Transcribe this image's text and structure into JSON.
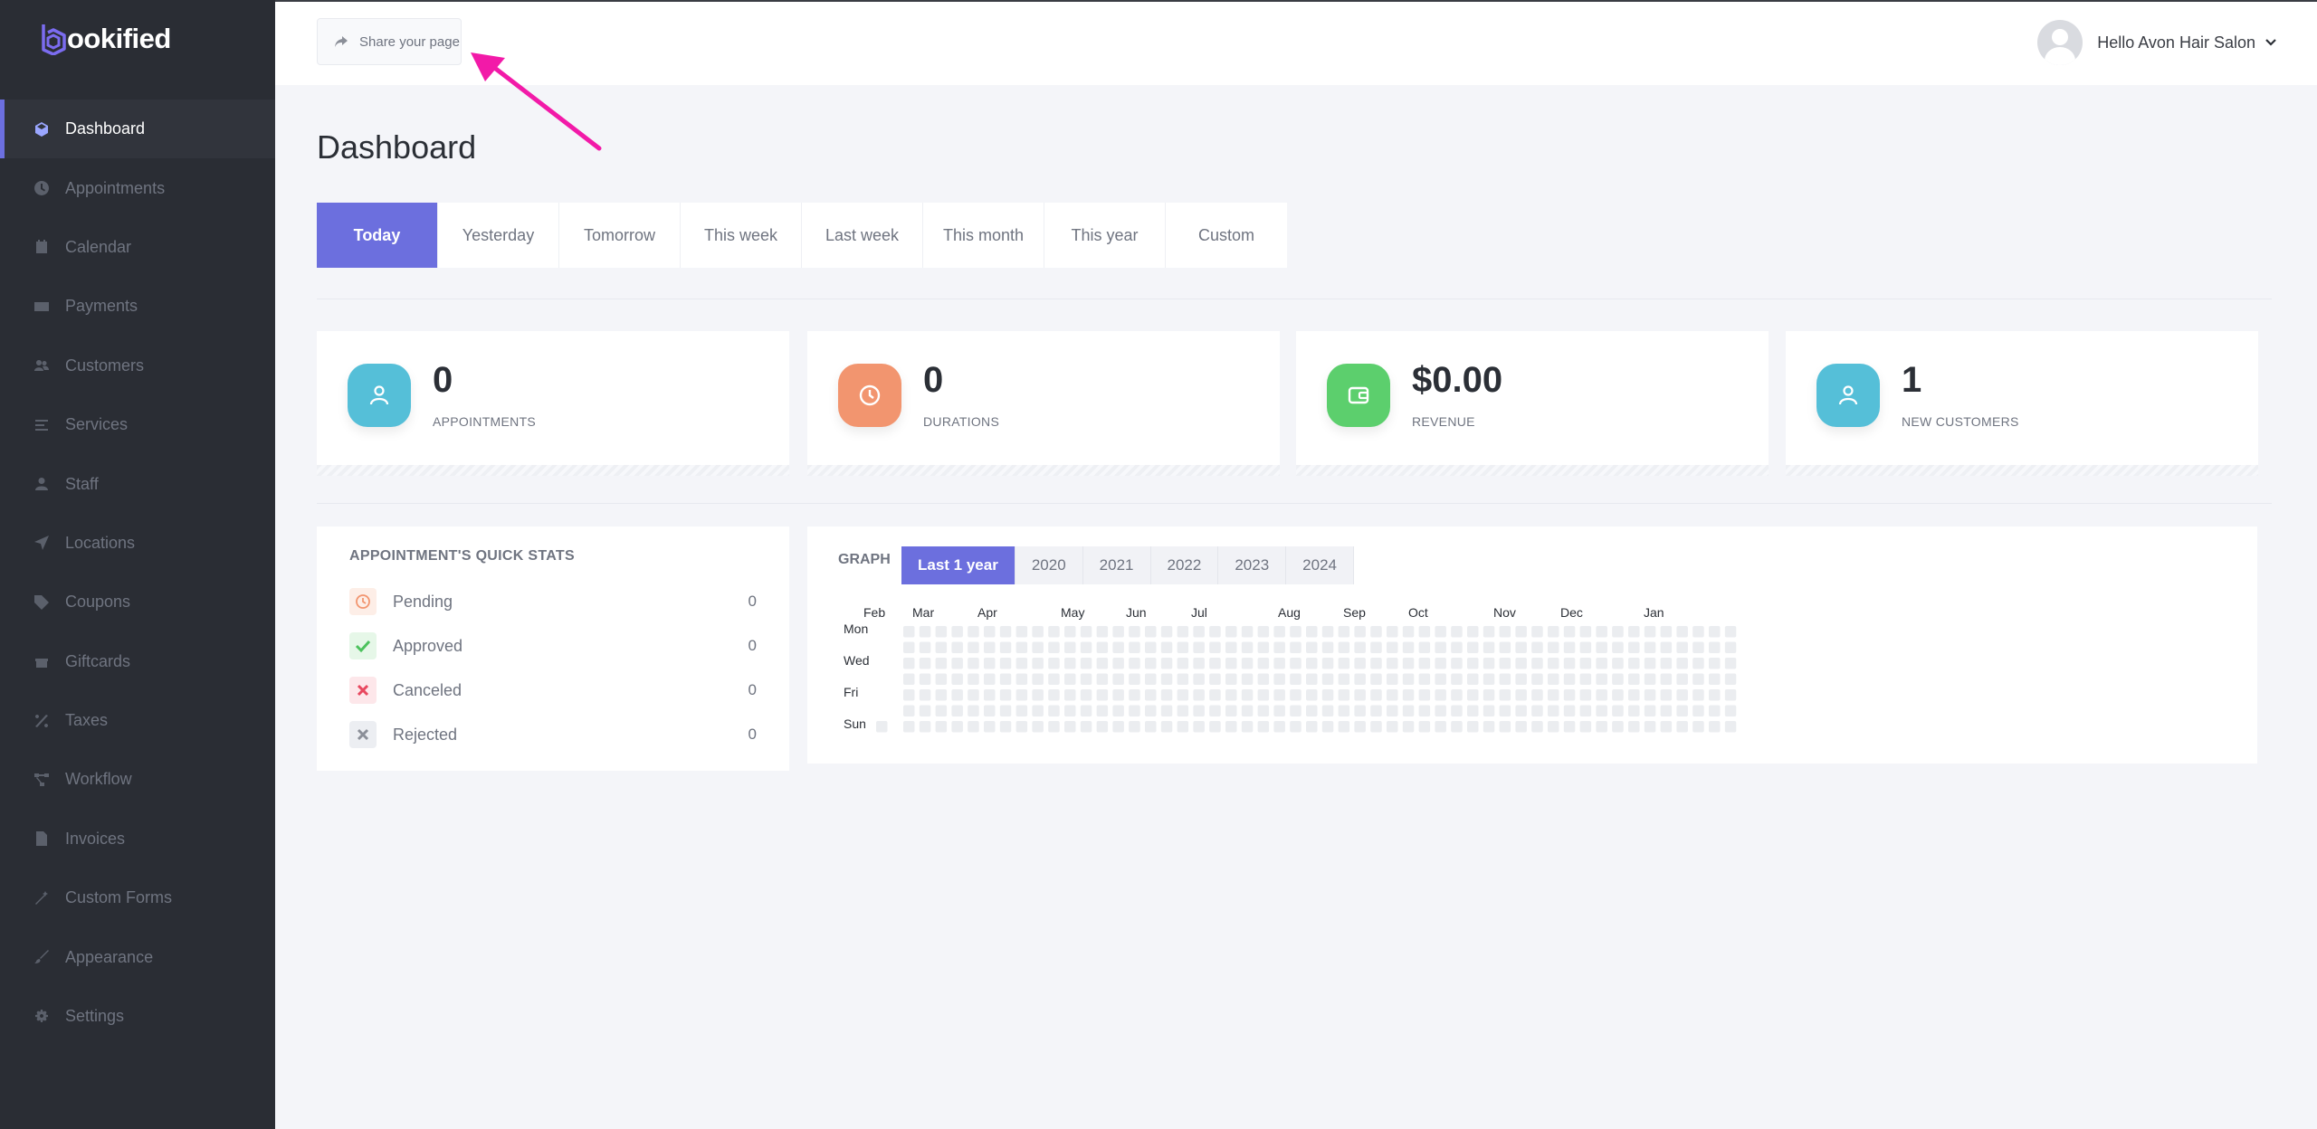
{
  "brand": {
    "logo_text": "ookified",
    "accent": "#6c6fde"
  },
  "sidebar": {
    "items": [
      {
        "label": "Dashboard",
        "icon": "cube-icon",
        "active": true
      },
      {
        "label": "Appointments",
        "icon": "clock-icon"
      },
      {
        "label": "Calendar",
        "icon": "calendar-icon"
      },
      {
        "label": "Payments",
        "icon": "credit-card-icon"
      },
      {
        "label": "Customers",
        "icon": "users-icon"
      },
      {
        "label": "Services",
        "icon": "list-icon"
      },
      {
        "label": "Staff",
        "icon": "user-icon"
      },
      {
        "label": "Locations",
        "icon": "location-arrow-icon"
      },
      {
        "label": "Coupons",
        "icon": "tag-icon"
      },
      {
        "label": "Giftcards",
        "icon": "gift-icon"
      },
      {
        "label": "Taxes",
        "icon": "percent-icon"
      },
      {
        "label": "Workflow",
        "icon": "workflow-icon"
      },
      {
        "label": "Invoices",
        "icon": "file-icon"
      },
      {
        "label": "Custom Forms",
        "icon": "magic-icon"
      },
      {
        "label": "Appearance",
        "icon": "brush-icon"
      },
      {
        "label": "Settings",
        "icon": "gear-icon"
      }
    ]
  },
  "topbar": {
    "share_label": "Share your page",
    "greeting": "Hello Avon Hair Salon"
  },
  "page": {
    "title": "Dashboard"
  },
  "date_tabs": [
    {
      "label": "Today",
      "active": true
    },
    {
      "label": "Yesterday"
    },
    {
      "label": "Tomorrow"
    },
    {
      "label": "This week"
    },
    {
      "label": "Last week"
    },
    {
      "label": "This month"
    },
    {
      "label": "This year"
    },
    {
      "label": "Custom"
    }
  ],
  "stats": [
    {
      "value": "0",
      "label": "APPOINTMENTS",
      "color": "#55bfd8",
      "icon": "user-icon"
    },
    {
      "value": "0",
      "label": "DURATIONS",
      "color": "#f2956f",
      "icon": "clock-icon"
    },
    {
      "value": "$0.00",
      "label": "REVENUE",
      "color": "#5ccf6d",
      "icon": "wallet-icon"
    },
    {
      "value": "1",
      "label": "NEW CUSTOMERS",
      "color": "#55bfd8",
      "icon": "user-icon"
    }
  ],
  "quick_stats": {
    "title": "APPOINTMENT'S QUICK STATS",
    "rows": [
      {
        "label": "Pending",
        "count": "0",
        "icon": "clock-icon",
        "color": "#f2956f",
        "bg": "#fdeee7"
      },
      {
        "label": "Approved",
        "count": "0",
        "icon": "check-icon",
        "color": "#4cc25d",
        "bg": "#e6f7e8"
      },
      {
        "label": "Canceled",
        "count": "0",
        "icon": "x-icon",
        "color": "#e8485f",
        "bg": "#fde7ea"
      },
      {
        "label": "Rejected",
        "count": "0",
        "icon": "x-icon",
        "color": "#8b8f98",
        "bg": "#eceef2"
      }
    ]
  },
  "graph": {
    "title": "GRAPH",
    "year_tabs": [
      {
        "label": "Last 1 year",
        "active": true
      },
      {
        "label": "2020"
      },
      {
        "label": "2021"
      },
      {
        "label": "2022"
      },
      {
        "label": "2023"
      },
      {
        "label": "2024"
      }
    ],
    "months": [
      "Feb",
      "Mar",
      "Apr",
      "May",
      "Jun",
      "Jul",
      "Aug",
      "Sep",
      "Oct",
      "Nov",
      "Dec",
      "Jan"
    ],
    "days": [
      "Mon",
      "Wed",
      "Fri",
      "Sun"
    ],
    "cell_color": "#ebedf0"
  }
}
